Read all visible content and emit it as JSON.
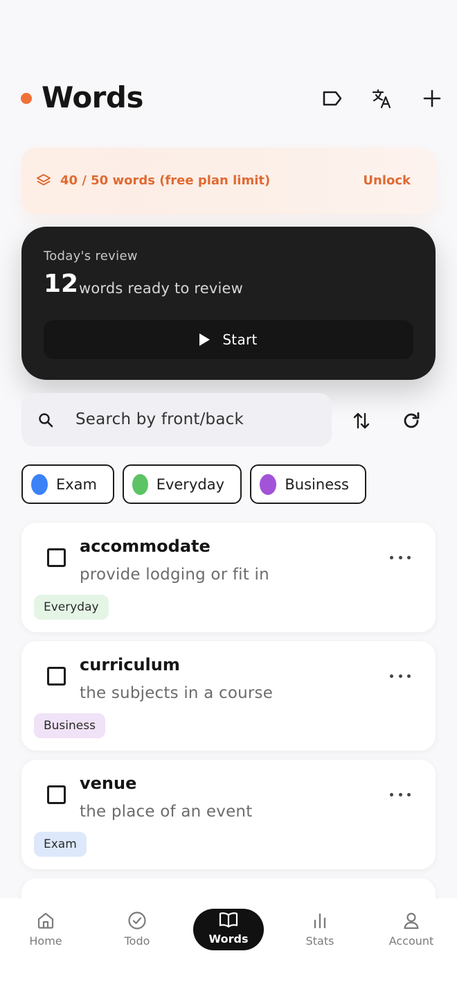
{
  "header": {
    "title": "Words"
  },
  "limit_banner": {
    "text": "40 / 50 words (free plan limit)",
    "unlock_label": "Unlock"
  },
  "review": {
    "label": "Today's review",
    "count": "12",
    "description": "words ready to review",
    "start_label": "Start"
  },
  "search": {
    "placeholder": "Search by front/back",
    "value": ""
  },
  "filters": [
    {
      "label": "Exam",
      "color": "#3b82f6"
    },
    {
      "label": "Everyday",
      "color": "#5cc465"
    },
    {
      "label": "Business",
      "color": "#a154d8"
    }
  ],
  "words": [
    {
      "front": "accommodate",
      "back": "provide lodging or fit in",
      "tag": "Everyday",
      "tag_color": "#e4f5e6"
    },
    {
      "front": "curriculum",
      "back": "the subjects in a course",
      "tag": "Business",
      "tag_color": "#f0e2f7"
    },
    {
      "front": "venue",
      "back": "the place of an event",
      "tag": "Exam",
      "tag_color": "#dde9fb"
    }
  ],
  "nav": [
    {
      "label": "Home",
      "icon": "home-icon"
    },
    {
      "label": "Todo",
      "icon": "check-circle-icon"
    },
    {
      "label": "Words",
      "icon": "book-open-icon"
    },
    {
      "label": "Stats",
      "icon": "bar-chart-icon"
    },
    {
      "label": "Account",
      "icon": "user-icon"
    }
  ],
  "colors": {
    "accent": "#f07137",
    "dark": "#1e1e1f"
  }
}
